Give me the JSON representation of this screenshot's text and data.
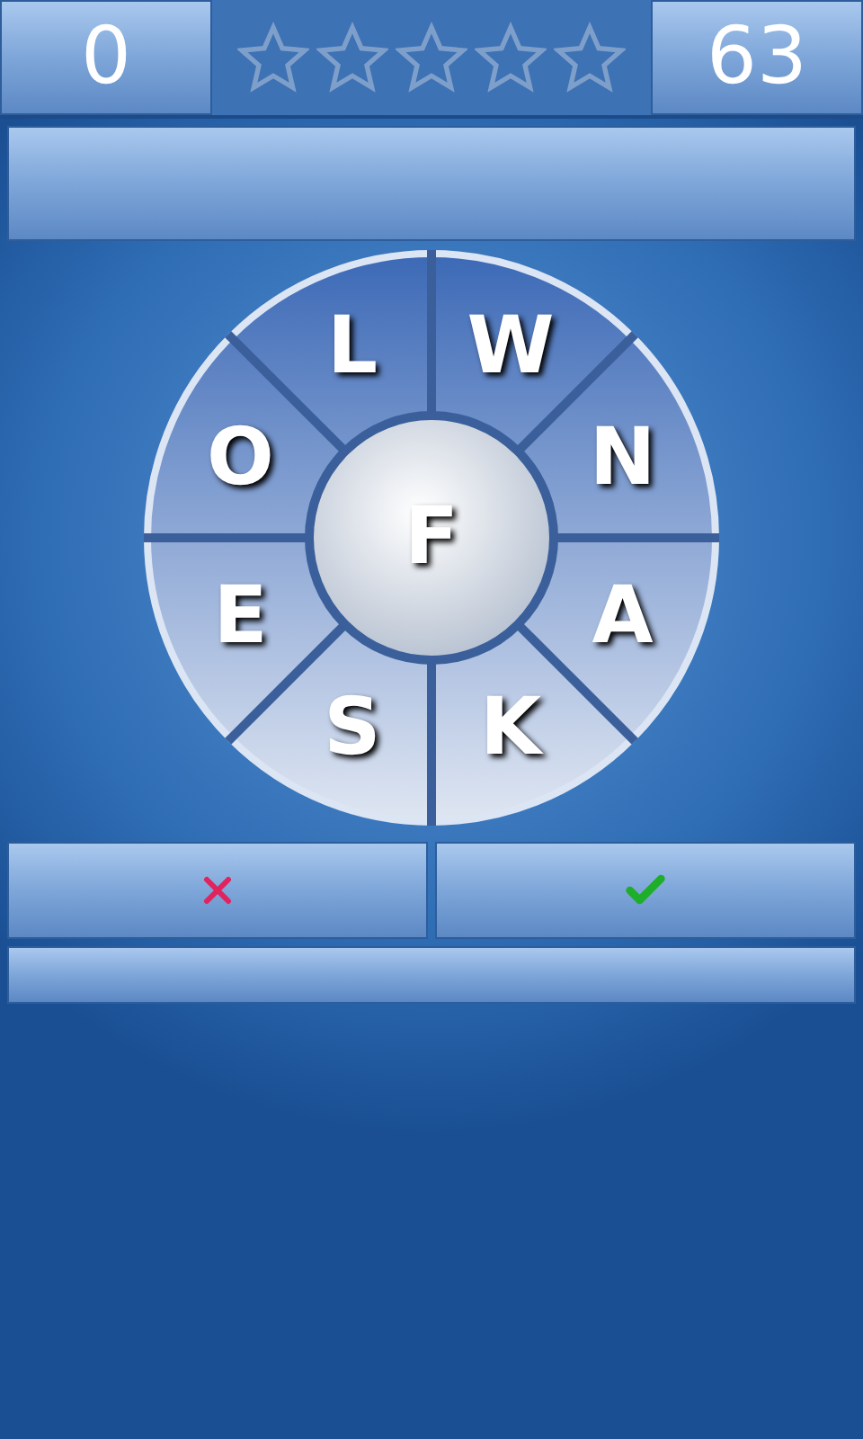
{
  "header": {
    "score": "0",
    "stars": 0,
    "total": "63"
  },
  "wheel": {
    "center": "F",
    "letters": [
      {
        "letter": "W"
      },
      {
        "letter": "N"
      },
      {
        "letter": "A"
      },
      {
        "letter": "K"
      },
      {
        "letter": "S"
      },
      {
        "letter": "E"
      },
      {
        "letter": "O"
      },
      {
        "letter": "L"
      }
    ]
  }
}
